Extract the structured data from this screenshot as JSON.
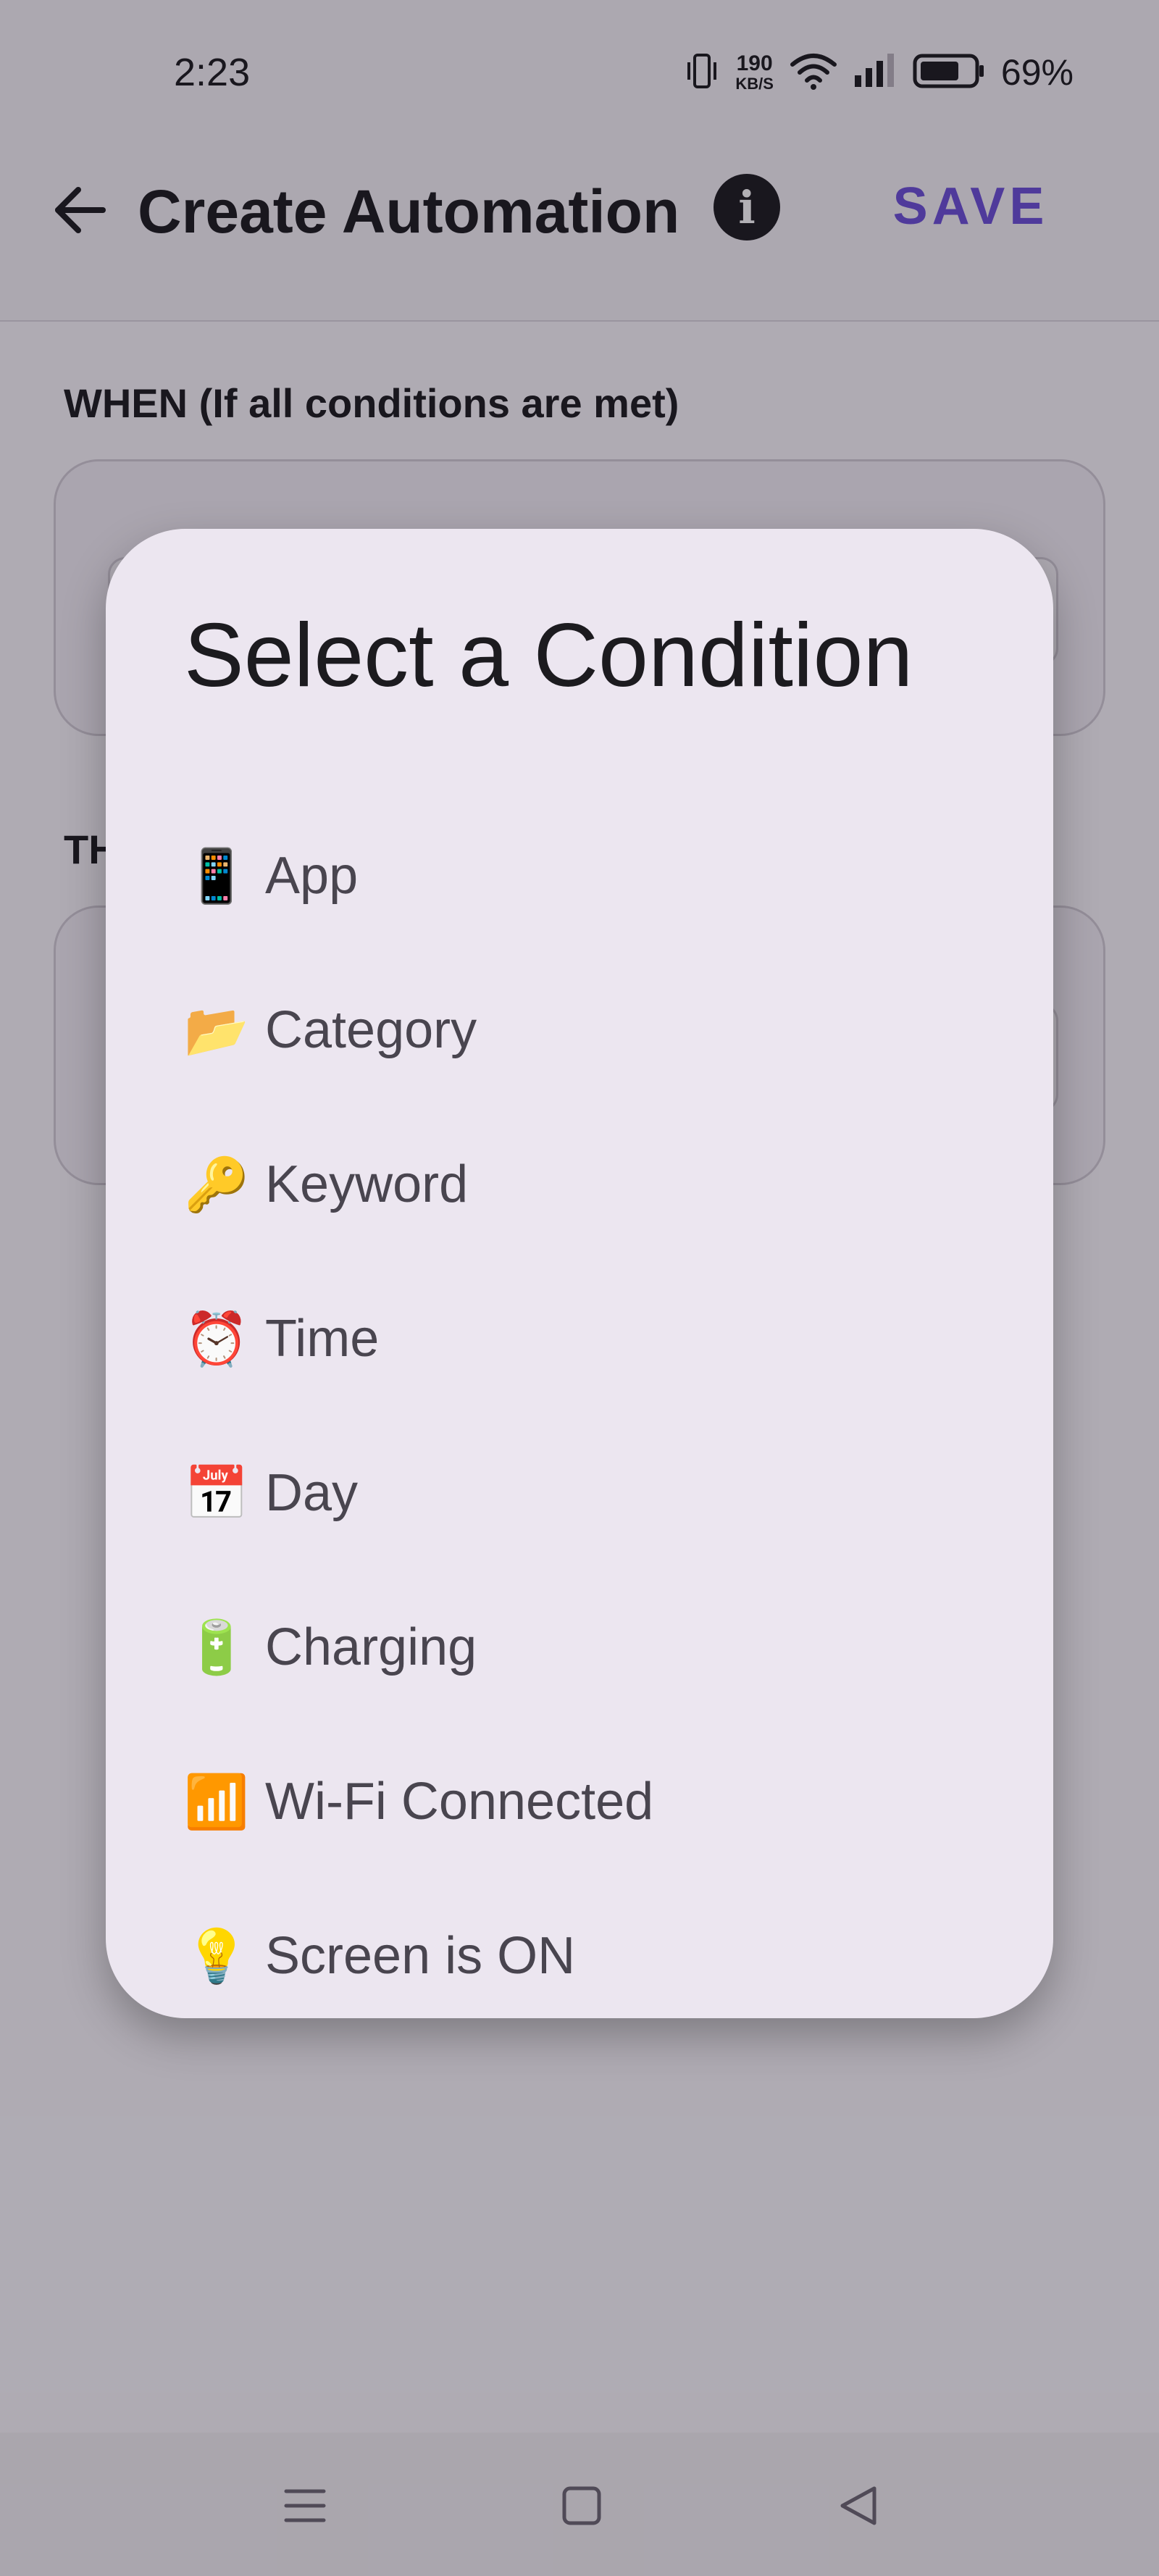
{
  "status_bar": {
    "time": "2:23",
    "net_speed_value": "190",
    "net_speed_unit": "KB/S",
    "battery_percent": "69%",
    "icons": [
      "vibrate-icon",
      "wifi-icon",
      "signal-icon",
      "battery-icon"
    ]
  },
  "app_bar": {
    "title": "Create Automation",
    "save_label": "SAVE",
    "info_icon": "i",
    "accent_color": "#6c4fd8"
  },
  "main": {
    "when_label": "WHEN (If all conditions are met)",
    "then_label": "TH"
  },
  "dialog": {
    "title": "Select a Condition",
    "items": [
      {
        "emoji": "📱",
        "icon": "mobile-phone-icon",
        "label": "App"
      },
      {
        "emoji": "📂",
        "icon": "folder-icon",
        "label": "Category"
      },
      {
        "emoji": "🔑",
        "icon": "key-icon",
        "label": "Keyword"
      },
      {
        "emoji": "⏰",
        "icon": "alarm-clock-icon",
        "label": "Time"
      },
      {
        "emoji": "📅",
        "icon": "calendar-icon",
        "label": "Day"
      },
      {
        "emoji": "🔋",
        "icon": "battery-icon",
        "label": "Charging"
      },
      {
        "emoji": "📶",
        "icon": "signal-bars-icon",
        "label": "Wi-Fi Connected"
      },
      {
        "emoji": "💡",
        "icon": "light-bulb-icon",
        "label": "Screen is ON"
      }
    ]
  },
  "nav_bar": {
    "icons": [
      "menu-icon",
      "home-icon",
      "back-icon"
    ]
  }
}
